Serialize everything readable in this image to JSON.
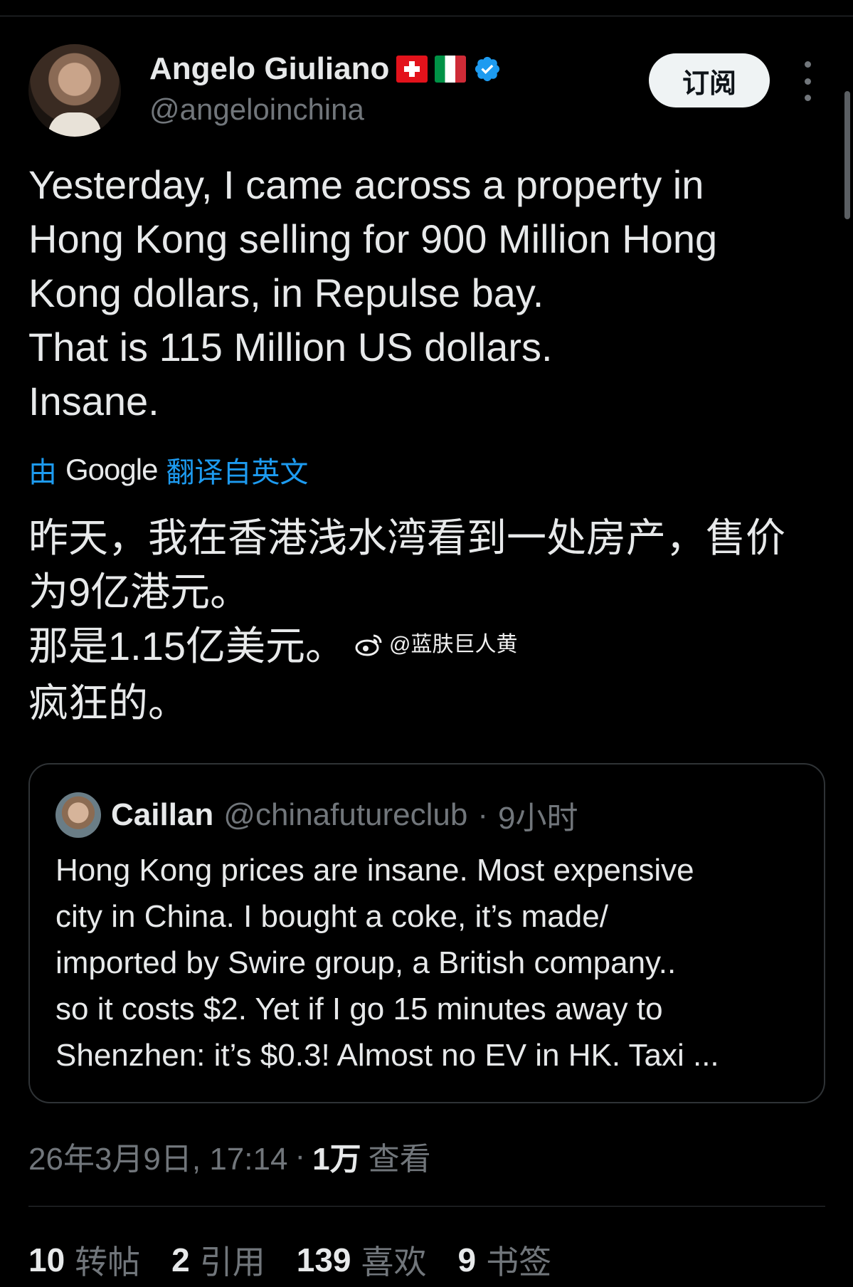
{
  "author": {
    "display_name": "Angelo Giuliano",
    "handle": "@angeloinchina",
    "flags": [
      "swiss-flag-icon",
      "italy-flag-icon"
    ],
    "verified": true,
    "subscribe_label": "订阅"
  },
  "tweet": {
    "text_lines": [
      "Yesterday, I came across a property in",
      "Hong Kong selling for 900 Million Hong",
      "Kong dollars, in Repulse bay.",
      "That is 115 Million US dollars.",
      "Insane."
    ]
  },
  "translation": {
    "prefix": "由",
    "provider": "Google",
    "suffix": "翻译自英文",
    "text_lines": [
      "昨天，我在香港浅水湾看到一处房产，售价",
      "为9亿港元。",
      "那是1.15亿美元。",
      "疯狂的。"
    ]
  },
  "watermark": {
    "text": "@蓝肤巨人黄",
    "icon": "weibo-icon"
  },
  "quote": {
    "display_name": "Caillan",
    "handle": "@chinafutureclub",
    "separator": "·",
    "time": "9小时",
    "text_lines": [
      "Hong Kong prices are insane. Most expensive",
      "city in China. I bought a coke, it’s made/",
      "imported by Swire group, a British company..",
      "so it costs $2. Yet if I go 15 minutes away to",
      "Shenzhen: it’s $0.3! Almost no EV in HK. Taxi ..."
    ]
  },
  "meta": {
    "timestamp": "26年3月9日, 17:14",
    "separator": "·",
    "views_count": "1万",
    "views_label": "查看"
  },
  "stats": [
    {
      "count": "10",
      "label": "转帖"
    },
    {
      "count": "2",
      "label": "引用"
    },
    {
      "count": "139",
      "label": "喜欢"
    },
    {
      "count": "9",
      "label": "书签"
    }
  ],
  "colors": {
    "background": "#000000",
    "text": "#e7e9ea",
    "muted": "#71767b",
    "accent": "#1d9bf0",
    "border": "#2f3336"
  }
}
